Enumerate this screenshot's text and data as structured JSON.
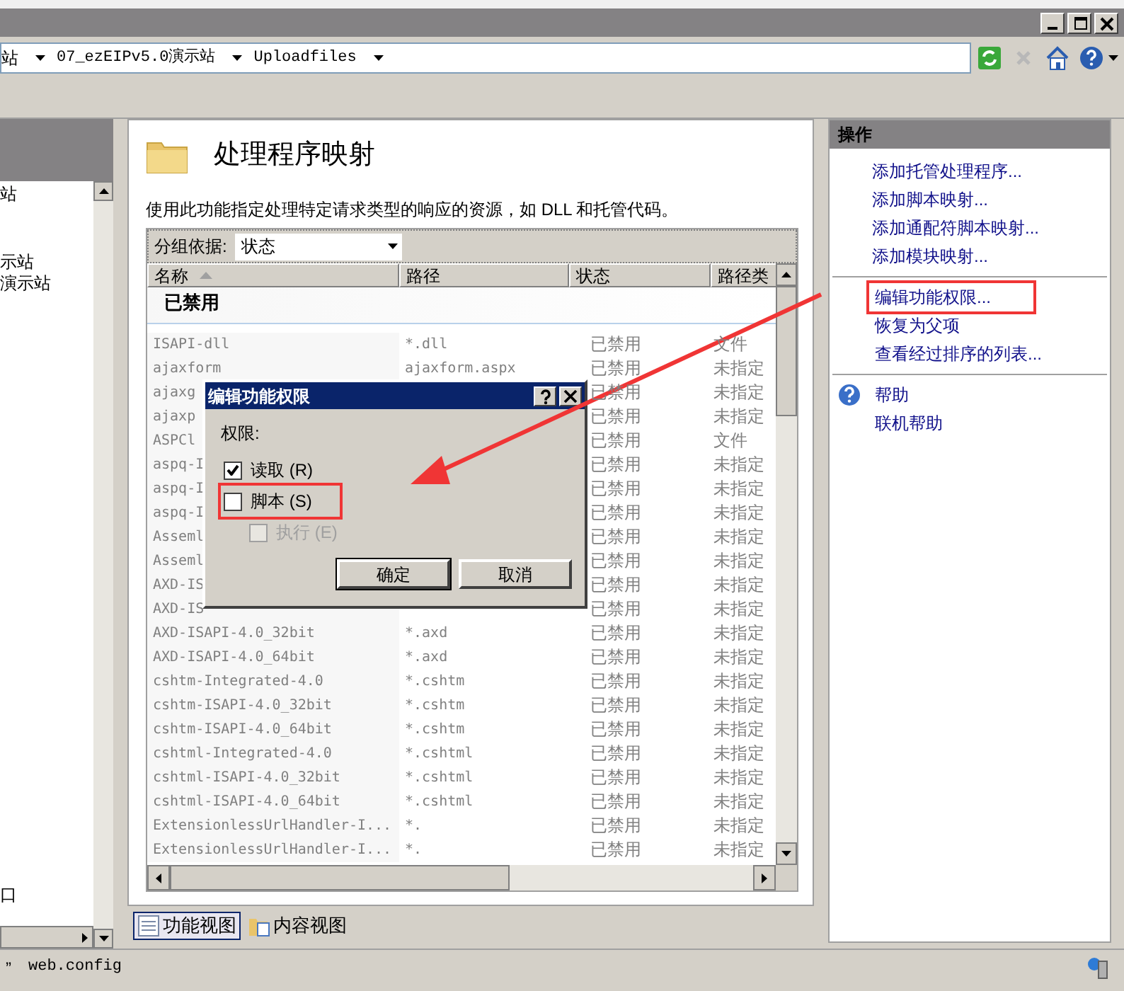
{
  "address_bar": {
    "crumbs": [
      "站",
      "07_ezEIPv5.0演示站",
      "Uploadfiles"
    ]
  },
  "toolbar": [
    {
      "kind": "refresh",
      "disabled": false
    },
    {
      "kind": "stop",
      "disabled": true
    },
    {
      "kind": "home",
      "disabled": false
    },
    {
      "kind": "help",
      "disabled": false
    }
  ],
  "tree": {
    "items": [
      "站",
      "示站",
      "演示站",
      "口"
    ]
  },
  "page": {
    "title": "处理程序映射",
    "description": "使用此功能指定处理特定请求类型的响应的资源，如 DLL 和托管代码。"
  },
  "group_by": {
    "label": "分组依据:",
    "value": "状态"
  },
  "table": {
    "columns": [
      {
        "label": "名称",
        "sorted": true
      },
      {
        "label": "路径",
        "sorted": false
      },
      {
        "label": "状态",
        "sorted": false
      },
      {
        "label": "路径类",
        "sorted": false
      }
    ],
    "group": "已禁用",
    "rows": [
      [
        "ISAPI-dll",
        "*.dll",
        "已禁用",
        "文件"
      ],
      [
        "ajaxform",
        "ajaxform.aspx",
        "已禁用",
        "未指定"
      ],
      [
        "ajaxg",
        "",
        "已禁用",
        "未指定"
      ],
      [
        "ajaxp",
        "",
        "已禁用",
        "未指定"
      ],
      [
        "ASPCl",
        "",
        "已禁用",
        "文件"
      ],
      [
        "aspq-I",
        "",
        "已禁用",
        "未指定"
      ],
      [
        "aspq-I",
        "",
        "已禁用",
        "未指定"
      ],
      [
        "aspq-I",
        "",
        "已禁用",
        "未指定"
      ],
      [
        "Asseml",
        "",
        "已禁用",
        "未指定"
      ],
      [
        "Asseml",
        "",
        "已禁用",
        "未指定"
      ],
      [
        "AXD-IS",
        "",
        "已禁用",
        "未指定"
      ],
      [
        "AXD-IS",
        "",
        "已禁用",
        "未指定"
      ],
      [
        "AXD-ISAPI-4.0_32bit",
        "*.axd",
        "已禁用",
        "未指定"
      ],
      [
        "AXD-ISAPI-4.0_64bit",
        "*.axd",
        "已禁用",
        "未指定"
      ],
      [
        "cshtm-Integrated-4.0",
        "*.cshtm",
        "已禁用",
        "未指定"
      ],
      [
        "cshtm-ISAPI-4.0_32bit",
        "*.cshtm",
        "已禁用",
        "未指定"
      ],
      [
        "cshtm-ISAPI-4.0_64bit",
        "*.cshtm",
        "已禁用",
        "未指定"
      ],
      [
        "cshtml-Integrated-4.0",
        "*.cshtml",
        "已禁用",
        "未指定"
      ],
      [
        "cshtml-ISAPI-4.0_32bit",
        "*.cshtml",
        "已禁用",
        "未指定"
      ],
      [
        "cshtml-ISAPI-4.0_64bit",
        "*.cshtml",
        "已禁用",
        "未指定"
      ],
      [
        "ExtensionlessUrlHandler-I...",
        "*.",
        "已禁用",
        "未指定"
      ],
      [
        "ExtensionlessUrlHandler-I...",
        "*.",
        "已禁用",
        "未指定"
      ]
    ]
  },
  "dialog": {
    "title": "编辑功能权限",
    "section": "权限:",
    "options": [
      {
        "label": "读取 (R)",
        "checked": true,
        "disabled": false,
        "highlighted": false
      },
      {
        "label": "脚本 (S)",
        "checked": false,
        "disabled": false,
        "highlighted": true
      },
      {
        "label": "执行 (E)",
        "checked": false,
        "disabled": true,
        "highlighted": false
      }
    ],
    "buttons": [
      "确定",
      "取消"
    ]
  },
  "actions": {
    "title": "操作",
    "groups": [
      [
        {
          "label": "添加托管处理程序...",
          "kind": "link",
          "highlighted": false
        },
        {
          "label": "添加脚本映射...",
          "kind": "link",
          "highlighted": false
        },
        {
          "label": "添加通配符脚本映射...",
          "kind": "link",
          "highlighted": false
        },
        {
          "label": "添加模块映射...",
          "kind": "link",
          "highlighted": false
        }
      ],
      [
        {
          "label": "编辑功能权限...",
          "kind": "link",
          "highlighted": true
        },
        {
          "label": "恢复为父项",
          "kind": "link",
          "highlighted": false
        },
        {
          "label": "查看经过排序的列表...",
          "kind": "link",
          "highlighted": false
        }
      ],
      [
        {
          "label": "帮助",
          "kind": "help",
          "highlighted": false
        },
        {
          "label": "联机帮助",
          "kind": "link",
          "highlighted": false
        }
      ]
    ]
  },
  "view_tabs": [
    {
      "label": "功能视图",
      "selected": true,
      "kind": "features"
    },
    {
      "label": "内容视图",
      "selected": false,
      "kind": "content"
    }
  ],
  "status_bar": {
    "prefix": "”",
    "text": "web.config"
  }
}
